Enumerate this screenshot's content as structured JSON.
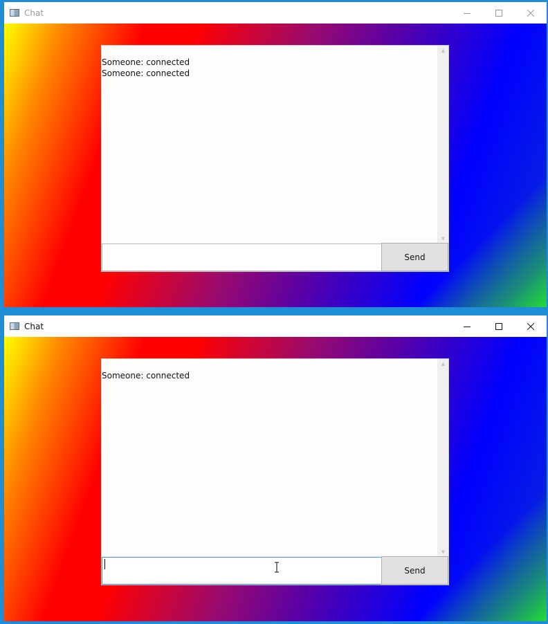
{
  "windows": [
    {
      "title": "Chat",
      "messages": [
        "Someone: connected",
        "Someone: connected"
      ],
      "input_value": "",
      "send_label": "Send",
      "focused": false
    },
    {
      "title": "Chat",
      "messages": [
        "Someone: connected"
      ],
      "input_value": "",
      "send_label": "Send",
      "focused": true
    }
  ],
  "icons": {
    "app": "app-icon",
    "minimize": "minimize-icon",
    "maximize": "maximize-icon",
    "close": "close-icon"
  },
  "colors": {
    "window_border": "#2b82d9",
    "button_face": "#e1e1e1",
    "focus_border": "#4a90d9"
  }
}
